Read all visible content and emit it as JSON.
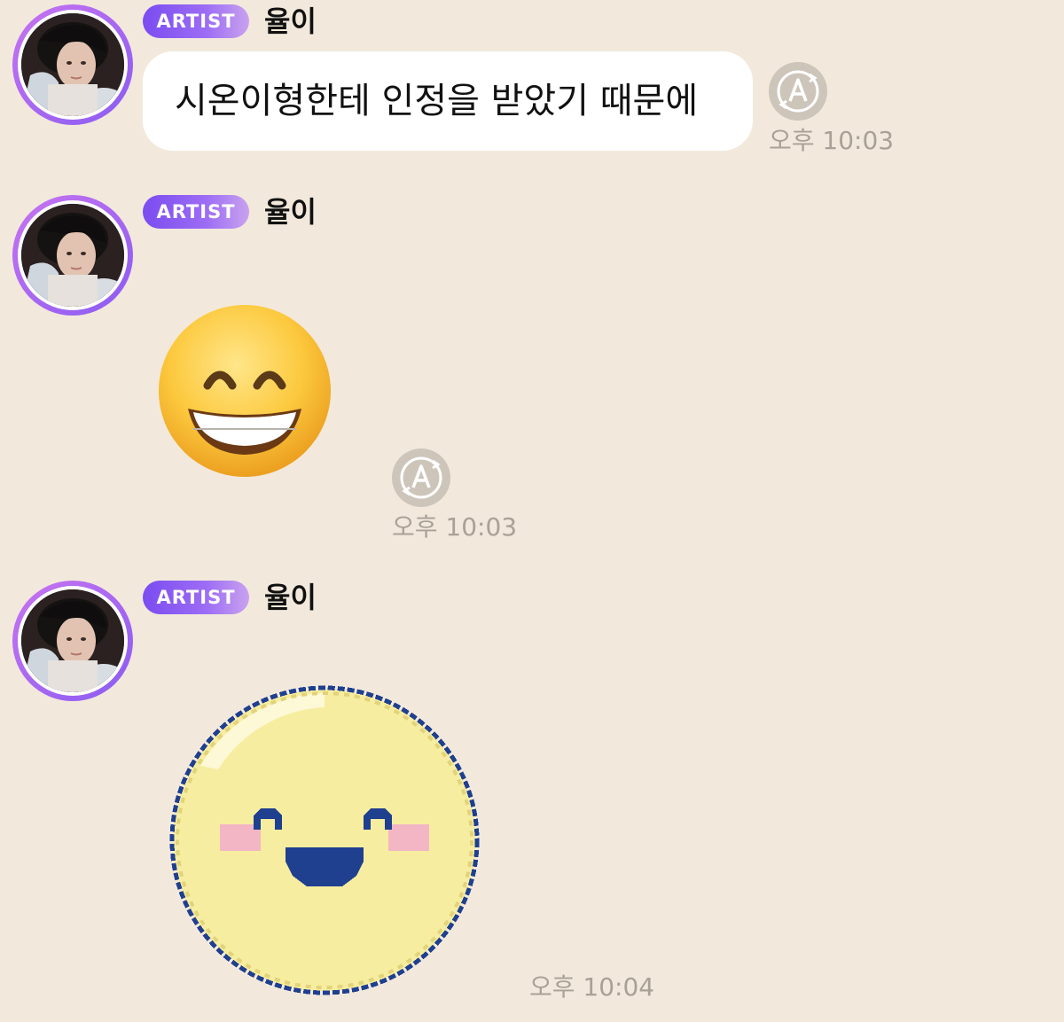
{
  "messages": [
    {
      "badge": "ARTIST",
      "sender": "율이",
      "text": "시온이형한테 인정을 받았기 때문에",
      "time": "오후 10:03",
      "translate_icon": "translate-icon"
    },
    {
      "badge": "ARTIST",
      "sender": "율이",
      "emoji": "grinning-face-with-smiling-eyes",
      "time": "오후 10:03",
      "translate_icon": "translate-icon"
    },
    {
      "badge": "ARTIST",
      "sender": "율이",
      "sticker": "pixel-smiling-face-sticker",
      "time": "오후 10:04"
    }
  ],
  "colors": {
    "background": "#f2e9dc",
    "badge_start": "#7b4cf0",
    "badge_end": "#c9a2ee",
    "avatar_ring": "#a866f2",
    "bubble": "#ffffff",
    "time_text": "#a9a097",
    "translate_button": "#cdc5ba"
  }
}
